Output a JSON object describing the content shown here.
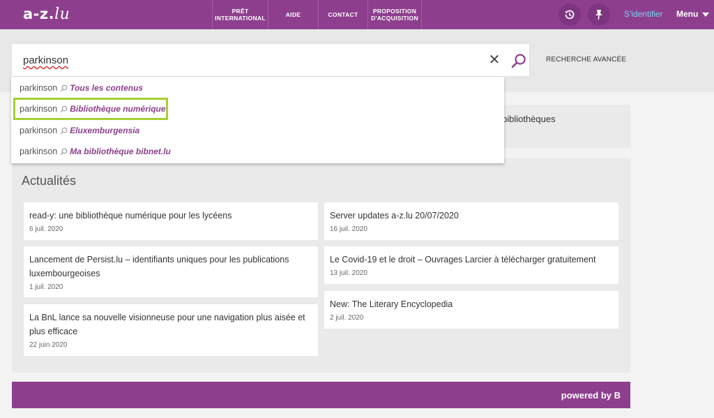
{
  "header": {
    "logo_main": "a-z.",
    "logo_suffix": "lu",
    "nav": [
      {
        "label": "PRÊT\nINTERNATIONAL"
      },
      {
        "label": "AIDE"
      },
      {
        "label": "CONTACT"
      },
      {
        "label": "PROPOSITION\nD'ACQUISITION"
      }
    ],
    "signin_label": "S'identifier",
    "menu_label": "Menu"
  },
  "search": {
    "query": "parkinson",
    "advanced_label": "RECHERCHE AVANCÉE",
    "suggestions": [
      {
        "term": "parkinson",
        "scope": "Tous les contenus"
      },
      {
        "term": "parkinson",
        "scope": "Bibliothèque numérique"
      },
      {
        "term": "parkinson",
        "scope": "Eluxemburgensia"
      },
      {
        "term": "parkinson",
        "scope": "Ma bibliothèque bibnet.lu"
      }
    ]
  },
  "libraries_partial_text": "bibliothèques",
  "news": {
    "title": "Actualités",
    "items": [
      {
        "title": "read-y: une bibliothèque numérique pour les lycéens",
        "date": "6 juil. 2020"
      },
      {
        "title": "Lancement de Persist.lu – identifiants uniques pour les publications luxembourgeoises",
        "date": "1 juil. 2020"
      },
      {
        "title": "La BnL lance sa nouvelle visionneuse pour une navigation plus aisée et plus efficace",
        "date": "22 juin 2020"
      },
      {
        "title": "Server updates a-z.lu 20/07/2020",
        "date": "16 juil. 2020"
      },
      {
        "title": "Le Covid-19 et le droit – Ouvrages Larcier à télécharger gratuitement",
        "date": "13 juil. 2020"
      },
      {
        "title": "New: The Literary Encyclopedia",
        "date": "2 juil. 2020"
      }
    ]
  },
  "footer": {
    "powered_label": "powered by B"
  },
  "colors": {
    "brand": "#8d3f8e",
    "highlight": "#a6cf32",
    "link_light": "#7fd0ef"
  },
  "icons": [
    "history-icon",
    "pin-icon",
    "close-icon",
    "search-icon",
    "magnifier-small-icon",
    "chevron-down-icon"
  ]
}
